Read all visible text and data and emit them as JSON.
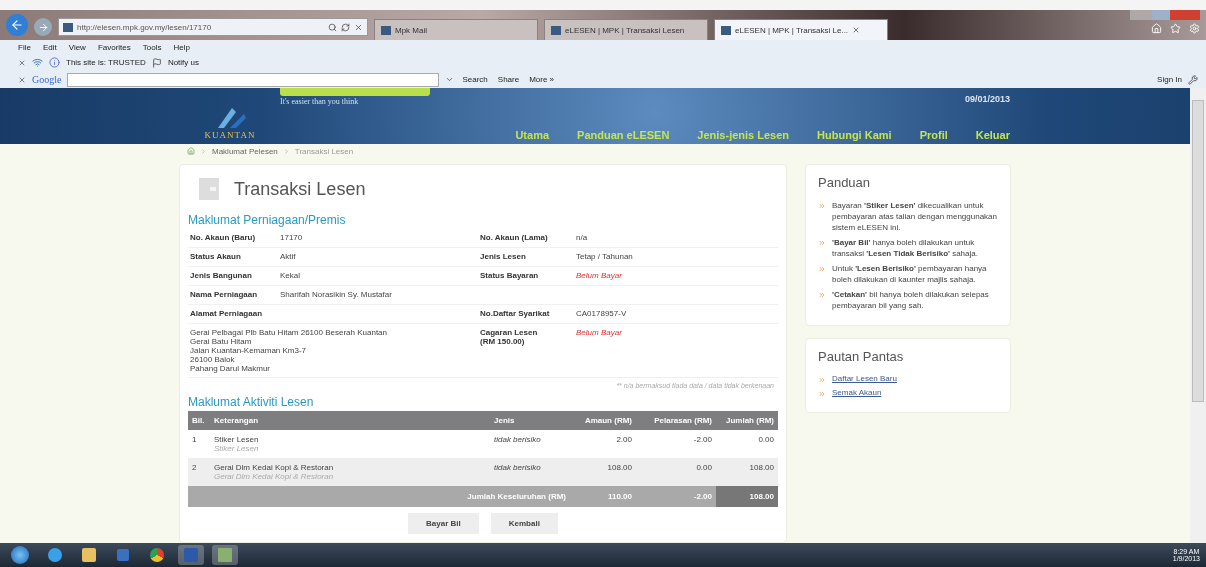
{
  "browser": {
    "address": "http://elesen.mpk.gov.my/lesen/17170",
    "tabs": [
      {
        "title": "Mpk Mail",
        "selected": false
      },
      {
        "title": "eLESEN | MPK | Transaksi Lesen",
        "selected": false
      },
      {
        "title": "eLESEN | MPK | Transaksi Le...",
        "selected": true
      }
    ],
    "menu": [
      "File",
      "Edit",
      "View",
      "Favorites",
      "Tools",
      "Help"
    ],
    "site_status": "This site is: TRUSTED",
    "notify": "Notify us",
    "google_label": "Google",
    "google_buttons": [
      "Search",
      "Share",
      "More »"
    ],
    "sign_in": "Sign In"
  },
  "header": {
    "logo_text": "KUANTAN",
    "tagline": "It's easier than you think",
    "date": "09/01/2013",
    "nav": [
      "Utama",
      "Panduan eLESEN",
      "Jenis-jenis Lesen",
      "Hubungi Kami",
      "Profil",
      "Keluar"
    ]
  },
  "breadcrumb": [
    "Maklumat Pelesen",
    "Transaksi Lesen"
  ],
  "page_title": "Transaksi Lesen",
  "premis": {
    "heading": "Maklumat Perniagaan/Premis",
    "rows": [
      [
        {
          "label": "No. Akaun (Baru)",
          "value": "17170"
        },
        {
          "label": "No. Akaun (Lama)",
          "value": "n/a"
        }
      ],
      [
        {
          "label": "Status Akaun",
          "value": "Aktif"
        },
        {
          "label": "Jenis Lesen",
          "value": "Tetap / Tahunan"
        }
      ],
      [
        {
          "label": "Jenis Bangunan",
          "value": "Kekal"
        },
        {
          "label": "Status Bayaran",
          "value": "Belum Bayar",
          "alert": true
        }
      ],
      [
        {
          "label": "Nama Perniagaan",
          "value": "Sharifah Norasikin Sy. Mustafar"
        },
        null
      ],
      [
        {
          "label": "Alamat Perniagaan"
        },
        {
          "label": "No.Daftar Syarikat",
          "value": "CA0178957-V"
        }
      ]
    ],
    "address_lines": [
      "Gerai Pelbagai Plb Batu Hitam 26100 Beserah Kuantan",
      "Gerai Batu Hitam",
      "Jalan Kuantan-Kemaman Km3-7",
      "26100 Balok",
      "Pahang Darul Makmur"
    ],
    "deposit": {
      "label": "Cagaran Lesen (RM 150.00)",
      "value": "Belum Bayar",
      "alert": true
    },
    "note": "** n/a bermaksud tiada data / data tidak berkenaan"
  },
  "aktiviti": {
    "heading": "Maklumat Aktiviti Lesen",
    "columns": [
      "Bil.",
      "Keterangan",
      "Jenis",
      "Amaun (RM)",
      "Pelarasan (RM)",
      "Jumlah (RM)"
    ],
    "rows": [
      {
        "no": "1",
        "name": "Stiker Lesen",
        "sub": "Stiker Lesen",
        "type": "tidak berisiko",
        "amount": "2.00",
        "adjust": "-2.00",
        "total": "0.00"
      },
      {
        "no": "2",
        "name": "Gerai Dlm Kedai Kopi & Restoran",
        "sub": "Gerai Dlm Kedai Kopi & Restoran",
        "type": "tidak berisiko",
        "amount": "108.00",
        "adjust": "0.00",
        "total": "108.00"
      }
    ],
    "total": {
      "label": "Jumlah Keseluruhan (RM)",
      "amount": "110.00",
      "adjust": "-2.00",
      "total": "108.00"
    },
    "buttons": [
      "Bayar Bil",
      "Kembali"
    ]
  },
  "panduan": {
    "title": "Panduan",
    "items": [
      "Bayaran **'Stiker Lesen'** dikecualikan untuk pembayaran atas talian dengan menggunakan sistem eLESEN ini.",
      "**'Bayar Bil'** hanya boleh dilakukan untuk transaksi **'Lesen Tidak Berisiko'** sahaja.",
      "Untuk **'Lesen Berisiko'** pembayaran hanya boleh dilakukan di kaunter majlis sahaja.",
      "**'Cetakan'** bil hanya boleh dilakukan selepas pembayaran bil yang sah."
    ]
  },
  "pautan": {
    "title": "Pautan Pantas",
    "links": [
      "Daftar Lesen Baru",
      "Semak Akaun"
    ]
  },
  "taskbar": {
    "time": "8:29 AM",
    "date": "1/9/2013"
  }
}
